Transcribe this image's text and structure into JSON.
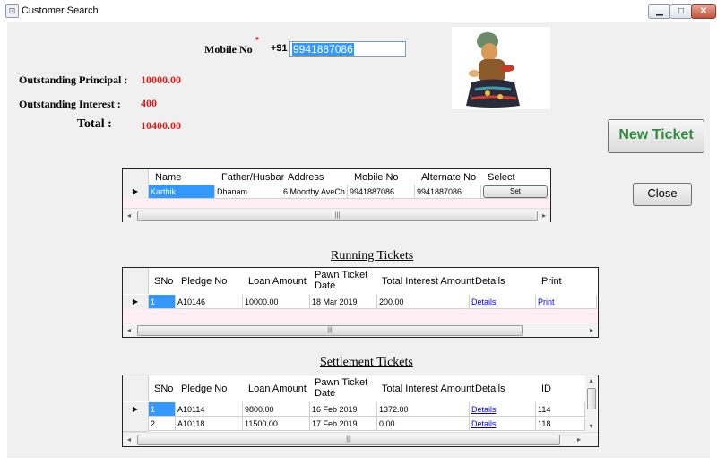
{
  "window": {
    "title": "Customer Search",
    "minimize": "▁",
    "maximize": "□",
    "close": "✕",
    "icon": "app-icon"
  },
  "customer": {
    "mobile_label": "Mobile No",
    "required_mark": "*",
    "country_code": "+91",
    "mobile_value": "9941887086",
    "outstanding_principal_label": "Outstanding Principal :",
    "outstanding_principal_value": "10000.00",
    "outstanding_interest_label": "Outstanding Interest :",
    "outstanding_interest_value": "400",
    "total_label": "Total :",
    "total_value": "10400.00"
  },
  "buttons": {
    "new_ticket": "New Ticket",
    "close": "Close",
    "set": "Set"
  },
  "customer_grid": {
    "headers": [
      "Name",
      "Father/Husband",
      "Address",
      "Mobile No",
      "Alternate No",
      "Select"
    ],
    "rows": [
      {
        "name": "Karthik",
        "father": "Dhanam",
        "address": "6,Moorthy AveCh...",
        "mobile": "9941887086",
        "alternate": "9941887086",
        "select": "Set"
      }
    ]
  },
  "running_tickets": {
    "title": "Running Tickets",
    "headers": [
      "SNo",
      "Pledge No",
      "Loan Amount",
      "Pawn Ticket Date",
      "Total Interest Amount",
      "Details",
      "Print"
    ],
    "rows": [
      {
        "sno": "1",
        "pledge": "A10146",
        "loan": "10000.00",
        "date": "18 Mar 2019",
        "interest": "200.00",
        "details": "Details",
        "print": "Print"
      }
    ]
  },
  "settlement_tickets": {
    "title": "Settlement Tickets",
    "headers": [
      "SNo",
      "Pledge No",
      "Loan Amount",
      "Pawn Ticket Date",
      "Total Interest Amount",
      "Details",
      "ID"
    ],
    "rows": [
      {
        "sno": "1",
        "pledge": "A10114",
        "loan": "9800.00",
        "date": "16 Feb 2019",
        "interest": "1372.00",
        "details": "Details",
        "id": "114"
      },
      {
        "sno": "2",
        "pledge": "A10118",
        "loan": "11500.00",
        "date": "17 Feb 2019",
        "interest": "0.00",
        "details": "Details",
        "id": "118"
      }
    ]
  },
  "scroll": {
    "left": "◂",
    "right": "▸",
    "up": "▴",
    "down": "▾",
    "grip": "|||",
    "row_pointer": "▶"
  }
}
